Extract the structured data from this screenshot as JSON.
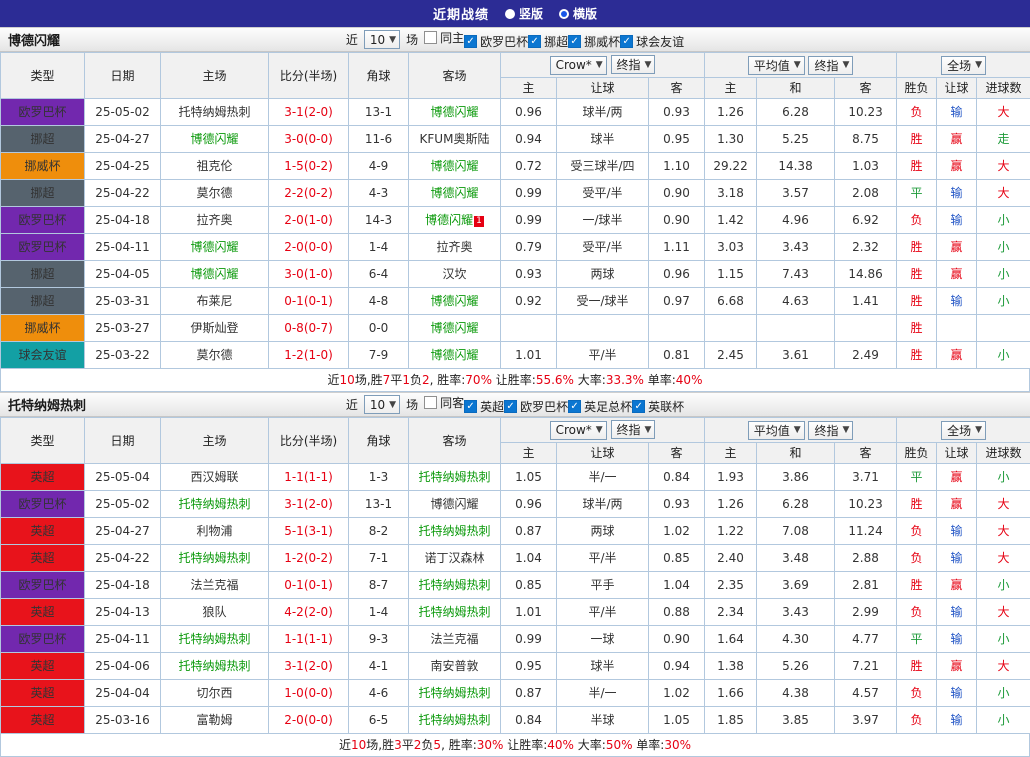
{
  "topbar": {
    "title": "近期战绩",
    "options": [
      {
        "label": "竖版",
        "selected": false
      },
      {
        "label": "横版",
        "selected": true
      }
    ]
  },
  "filter_labels": {
    "near": "近",
    "count": "10",
    "matches": "场"
  },
  "columns": {
    "type": "类型",
    "date": "日期",
    "home": "主场",
    "score": "比分(半场)",
    "corner": "角球",
    "away": "客场",
    "odds_home": "主",
    "odds_handicap": "让球",
    "odds_away": "客",
    "avg_home": "主",
    "avg_draw": "和",
    "avg_away": "客",
    "result": "胜负",
    "handicap_result": "让球",
    "goals": "进球数"
  },
  "header_selects": {
    "bookmaker": "Crow*",
    "final1": "终指",
    "average": "平均值",
    "final2": "终指",
    "scope": "全场"
  },
  "colors": {
    "league": {
      "欧罗巴杯": "#7228ae",
      "挪超": "#56636e",
      "挪威杯": "#ef8e0c",
      "球会友谊": "#13a0a4",
      "英超": "#e8131b"
    },
    "focus_team": "#0c9a0c",
    "score": "#e60012",
    "result": {
      "胜": "#e60012",
      "平": "#1e9b3a",
      "负": "#e60012"
    },
    "handicap": {
      "赢": "#e60012",
      "输": "#1f53c5"
    },
    "goals": {
      "大": "#e60012",
      "小": "#1e9b3a",
      "走": "#1e9b3a"
    },
    "value_red": "#e60012"
  },
  "sections": [
    {
      "team": "博德闪耀",
      "filters": [
        {
          "label": "同主",
          "checked": false
        },
        {
          "label": "欧罗巴杯",
          "checked": true
        },
        {
          "label": "挪超",
          "checked": true
        },
        {
          "label": "挪威杯",
          "checked": true
        },
        {
          "label": "球会友谊",
          "checked": true
        }
      ],
      "rows": [
        {
          "league": "欧罗巴杯",
          "date": "25-05-02",
          "home": "托特纳姆热刺",
          "home_focus": false,
          "score": "3-1(2-0)",
          "corner": "13-1",
          "away": "博德闪耀",
          "away_focus": true,
          "odds": [
            "0.96",
            "球半/两",
            "0.93"
          ],
          "avg": [
            "1.26",
            "6.28",
            "10.23"
          ],
          "result": "负",
          "handicap": "输",
          "goals": "大"
        },
        {
          "league": "挪超",
          "date": "25-04-27",
          "home": "博德闪耀",
          "home_focus": true,
          "score": "3-0(0-0)",
          "corner": "11-6",
          "away": "KFUM奥斯陆",
          "away_focus": false,
          "odds": [
            "0.94",
            "球半",
            "0.95"
          ],
          "avg": [
            "1.30",
            "5.25",
            "8.75"
          ],
          "result": "胜",
          "handicap": "赢",
          "goals": "走"
        },
        {
          "league": "挪威杯",
          "date": "25-04-25",
          "home": "祖克伦",
          "home_focus": false,
          "score": "1-5(0-2)",
          "corner": "4-9",
          "away": "博德闪耀",
          "away_focus": true,
          "odds": [
            "0.72",
            "受三球半/四",
            "1.10"
          ],
          "avg": [
            "29.22",
            "14.38",
            "1.03"
          ],
          "result": "胜",
          "handicap": "赢",
          "goals": "大"
        },
        {
          "league": "挪超",
          "date": "25-04-22",
          "home": "莫尔德",
          "home_focus": false,
          "score": "2-2(0-2)",
          "corner": "4-3",
          "away": "博德闪耀",
          "away_focus": true,
          "odds": [
            "0.99",
            "受平/半",
            "0.90"
          ],
          "avg": [
            "3.18",
            "3.57",
            "2.08"
          ],
          "result": "平",
          "handicap": "输",
          "goals": "大"
        },
        {
          "league": "欧罗巴杯",
          "date": "25-04-18",
          "home": "拉齐奥",
          "home_focus": false,
          "score": "2-0(1-0)",
          "corner": "14-3",
          "away": "博德闪耀",
          "away_focus": true,
          "away_badge": "1",
          "odds": [
            "0.99",
            "一/球半",
            "0.90"
          ],
          "avg": [
            "1.42",
            "4.96",
            "6.92"
          ],
          "result": "负",
          "handicap": "输",
          "goals": "小"
        },
        {
          "league": "欧罗巴杯",
          "date": "25-04-11",
          "home": "博德闪耀",
          "home_focus": true,
          "score": "2-0(0-0)",
          "corner": "1-4",
          "away": "拉齐奥",
          "away_focus": false,
          "odds": [
            "0.79",
            "受平/半",
            "1.11"
          ],
          "avg": [
            "3.03",
            "3.43",
            "2.32"
          ],
          "result": "胜",
          "handicap": "赢",
          "goals": "小"
        },
        {
          "league": "挪超",
          "date": "25-04-05",
          "home": "博德闪耀",
          "home_focus": true,
          "score": "3-0(1-0)",
          "corner": "6-4",
          "away": "汉坎",
          "away_focus": false,
          "odds": [
            "0.93",
            "两球",
            "0.96"
          ],
          "avg": [
            "1.15",
            "7.43",
            "14.86"
          ],
          "result": "胜",
          "handicap": "赢",
          "goals": "小"
        },
        {
          "league": "挪超",
          "date": "25-03-31",
          "home": "布莱尼",
          "home_focus": false,
          "score": "0-1(0-1)",
          "corner": "4-8",
          "away": "博德闪耀",
          "away_focus": true,
          "odds": [
            "0.92",
            "受一/球半",
            "0.97"
          ],
          "avg": [
            "6.68",
            "4.63",
            "1.41"
          ],
          "result": "胜",
          "handicap": "输",
          "goals": "小"
        },
        {
          "league": "挪威杯",
          "date": "25-03-27",
          "home": "伊斯灿登",
          "home_focus": false,
          "score": "0-8(0-7)",
          "corner": "0-0",
          "away": "博德闪耀",
          "away_focus": true,
          "odds": [
            "",
            "",
            ""
          ],
          "avg": [
            "",
            "",
            ""
          ],
          "result": "胜",
          "handicap": "",
          "goals": ""
        },
        {
          "league": "球会友谊",
          "date": "25-03-22",
          "home": "莫尔德",
          "home_focus": false,
          "score": "1-2(1-0)",
          "corner": "7-9",
          "away": "博德闪耀",
          "away_focus": true,
          "odds": [
            "1.01",
            "平/半",
            "0.81"
          ],
          "avg": [
            "2.45",
            "3.61",
            "2.49"
          ],
          "result": "胜",
          "handicap": "赢",
          "goals": "小"
        }
      ],
      "summary": [
        {
          "t": "近"
        },
        {
          "t": "10",
          "r": true
        },
        {
          "t": "场,胜"
        },
        {
          "t": "7",
          "r": true
        },
        {
          "t": "平"
        },
        {
          "t": "1",
          "r": true
        },
        {
          "t": "负"
        },
        {
          "t": "2",
          "r": true
        },
        {
          "t": ", 胜率:"
        },
        {
          "t": "70%",
          "r": true
        },
        {
          "t": " 让胜率:"
        },
        {
          "t": "55.6%",
          "r": true
        },
        {
          "t": " 大率:"
        },
        {
          "t": "33.3%",
          "r": true
        },
        {
          "t": " 单率:"
        },
        {
          "t": "40%",
          "r": true
        }
      ]
    },
    {
      "team": "托特纳姆热刺",
      "filters": [
        {
          "label": "同客",
          "checked": false
        },
        {
          "label": "英超",
          "checked": true
        },
        {
          "label": "欧罗巴杯",
          "checked": true
        },
        {
          "label": "英足总杯",
          "checked": true
        },
        {
          "label": "英联杯",
          "checked": true
        }
      ],
      "rows": [
        {
          "league": "英超",
          "date": "25-05-04",
          "home": "西汉姆联",
          "home_focus": false,
          "score": "1-1(1-1)",
          "corner": "1-3",
          "away": "托特纳姆热刺",
          "away_focus": true,
          "odds": [
            "1.05",
            "半/一",
            "0.84"
          ],
          "avg": [
            "1.93",
            "3.86",
            "3.71"
          ],
          "result": "平",
          "handicap": "赢",
          "goals": "小"
        },
        {
          "league": "欧罗巴杯",
          "date": "25-05-02",
          "home": "托特纳姆热刺",
          "home_focus": true,
          "score": "3-1(2-0)",
          "corner": "13-1",
          "away": "博德闪耀",
          "away_focus": false,
          "odds": [
            "0.96",
            "球半/两",
            "0.93"
          ],
          "avg": [
            "1.26",
            "6.28",
            "10.23"
          ],
          "result": "胜",
          "handicap": "赢",
          "goals": "大"
        },
        {
          "league": "英超",
          "date": "25-04-27",
          "home": "利物浦",
          "home_focus": false,
          "score": "5-1(3-1)",
          "corner": "8-2",
          "away": "托特纳姆热刺",
          "away_focus": true,
          "odds": [
            "0.87",
            "两球",
            "1.02"
          ],
          "avg": [
            "1.22",
            "7.08",
            "11.24"
          ],
          "result": "负",
          "handicap": "输",
          "goals": "大"
        },
        {
          "league": "英超",
          "date": "25-04-22",
          "home": "托特纳姆热刺",
          "home_focus": true,
          "score": "1-2(0-2)",
          "corner": "7-1",
          "away": "诺丁汉森林",
          "away_focus": false,
          "odds": [
            "1.04",
            "平/半",
            "0.85"
          ],
          "avg": [
            "2.40",
            "3.48",
            "2.88"
          ],
          "result": "负",
          "handicap": "输",
          "goals": "大"
        },
        {
          "league": "欧罗巴杯",
          "date": "25-04-18",
          "home": "法兰克福",
          "home_focus": false,
          "score": "0-1(0-1)",
          "corner": "8-7",
          "away": "托特纳姆热刺",
          "away_focus": true,
          "odds": [
            "0.85",
            "平手",
            "1.04"
          ],
          "avg": [
            "2.35",
            "3.69",
            "2.81"
          ],
          "result": "胜",
          "handicap": "赢",
          "goals": "小"
        },
        {
          "league": "英超",
          "date": "25-04-13",
          "home": "狼队",
          "home_focus": false,
          "score": "4-2(2-0)",
          "corner": "1-4",
          "away": "托特纳姆热刺",
          "away_focus": true,
          "odds": [
            "1.01",
            "平/半",
            "0.88"
          ],
          "avg": [
            "2.34",
            "3.43",
            "2.99"
          ],
          "result": "负",
          "handicap": "输",
          "goals": "大"
        },
        {
          "league": "欧罗巴杯",
          "date": "25-04-11",
          "home": "托特纳姆热刺",
          "home_focus": true,
          "score": "1-1(1-1)",
          "corner": "9-3",
          "away": "法兰克福",
          "away_focus": false,
          "odds": [
            "0.99",
            "一球",
            "0.90"
          ],
          "avg": [
            "1.64",
            "4.30",
            "4.77"
          ],
          "result": "平",
          "handicap": "输",
          "goals": "小"
        },
        {
          "league": "英超",
          "date": "25-04-06",
          "home": "托特纳姆热刺",
          "home_focus": true,
          "score": "3-1(2-0)",
          "corner": "4-1",
          "away": "南安普敦",
          "away_focus": false,
          "odds": [
            "0.95",
            "球半",
            "0.94"
          ],
          "avg": [
            "1.38",
            "5.26",
            "7.21"
          ],
          "result": "胜",
          "handicap": "赢",
          "goals": "大"
        },
        {
          "league": "英超",
          "date": "25-04-04",
          "home": "切尔西",
          "home_focus": false,
          "score": "1-0(0-0)",
          "corner": "4-6",
          "away": "托特纳姆热刺",
          "away_focus": true,
          "odds": [
            "0.87",
            "半/一",
            "1.02"
          ],
          "avg": [
            "1.66",
            "4.38",
            "4.57"
          ],
          "result": "负",
          "handicap": "输",
          "goals": "小"
        },
        {
          "league": "英超",
          "date": "25-03-16",
          "home": "富勒姆",
          "home_focus": false,
          "score": "2-0(0-0)",
          "corner": "6-5",
          "away": "托特纳姆热刺",
          "away_focus": true,
          "odds": [
            "0.84",
            "半球",
            "1.05"
          ],
          "avg": [
            "1.85",
            "3.85",
            "3.97"
          ],
          "result": "负",
          "handicap": "输",
          "goals": "小"
        }
      ],
      "summary": [
        {
          "t": "近"
        },
        {
          "t": "10",
          "r": true
        },
        {
          "t": "场,胜"
        },
        {
          "t": "3",
          "r": true
        },
        {
          "t": "平"
        },
        {
          "t": "2",
          "r": true
        },
        {
          "t": "负"
        },
        {
          "t": "5",
          "r": true
        },
        {
          "t": ", 胜率:"
        },
        {
          "t": "30%",
          "r": true
        },
        {
          "t": " 让胜率:"
        },
        {
          "t": "40%",
          "r": true
        },
        {
          "t": " 大率:"
        },
        {
          "t": "50%",
          "r": true
        },
        {
          "t": " 单率:"
        },
        {
          "t": "30%",
          "r": true
        }
      ]
    }
  ]
}
